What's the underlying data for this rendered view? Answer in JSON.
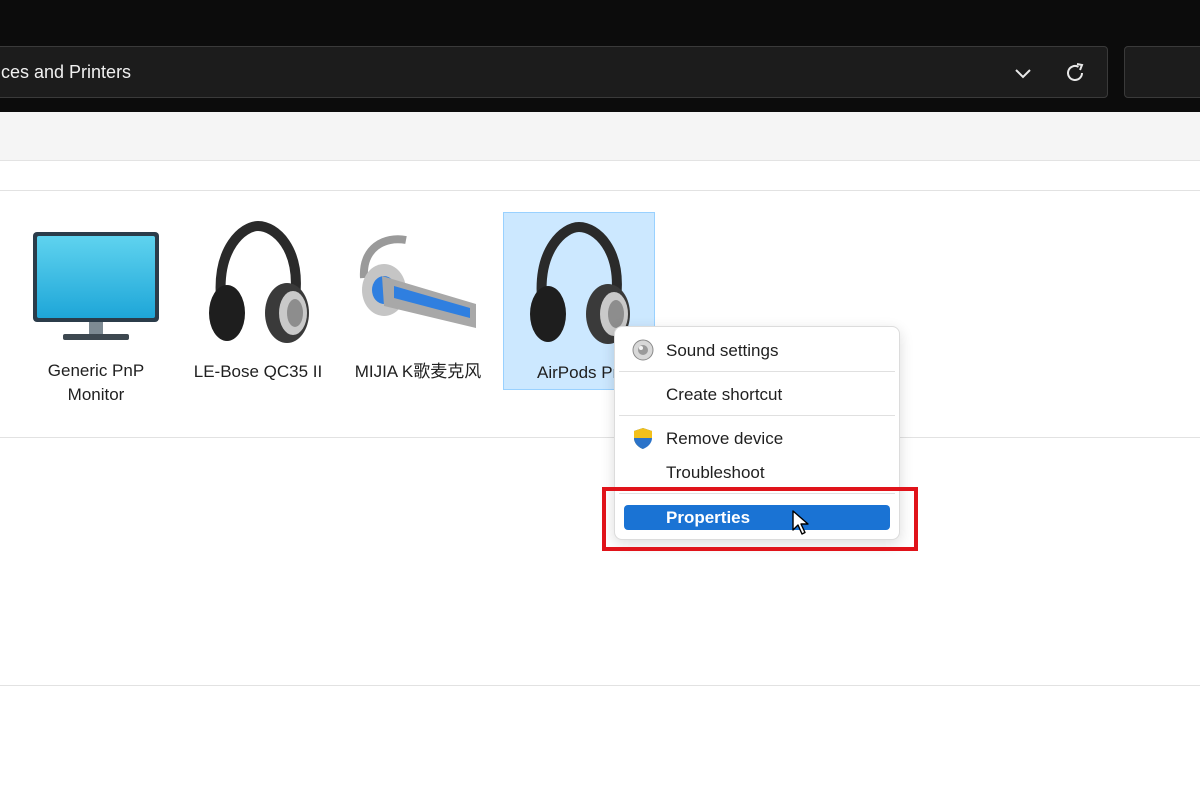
{
  "address_bar": {
    "path": "ces and Printers"
  },
  "devices": [
    {
      "name": "partial-device",
      "label": ""
    },
    {
      "name": "generic-pnp-monitor",
      "label_line1": "Generic PnP",
      "label_line2": "Monitor",
      "icon": "monitor-icon"
    },
    {
      "name": "le-bose-qc35",
      "label": "LE-Bose QC35 II",
      "icon": "headphones-icon"
    },
    {
      "name": "mijia-k",
      "label": "MIJIA K歌麦克风",
      "icon": "headset-icon"
    },
    {
      "name": "airpods",
      "label": "AirPods Pr",
      "icon": "headphones-icon",
      "selected": true
    }
  ],
  "context_menu": {
    "items": [
      {
        "label": "Sound settings",
        "icon": "speaker-icon"
      },
      {
        "label": "Create shortcut"
      },
      {
        "label": "Remove device",
        "icon": "shield-icon"
      },
      {
        "label": "Troubleshoot"
      },
      {
        "label": "Properties",
        "active": true
      }
    ]
  },
  "colors": {
    "highlight_box": "#e0131a",
    "menu_active": "#1a73d4",
    "selection": "#cce8ff"
  }
}
